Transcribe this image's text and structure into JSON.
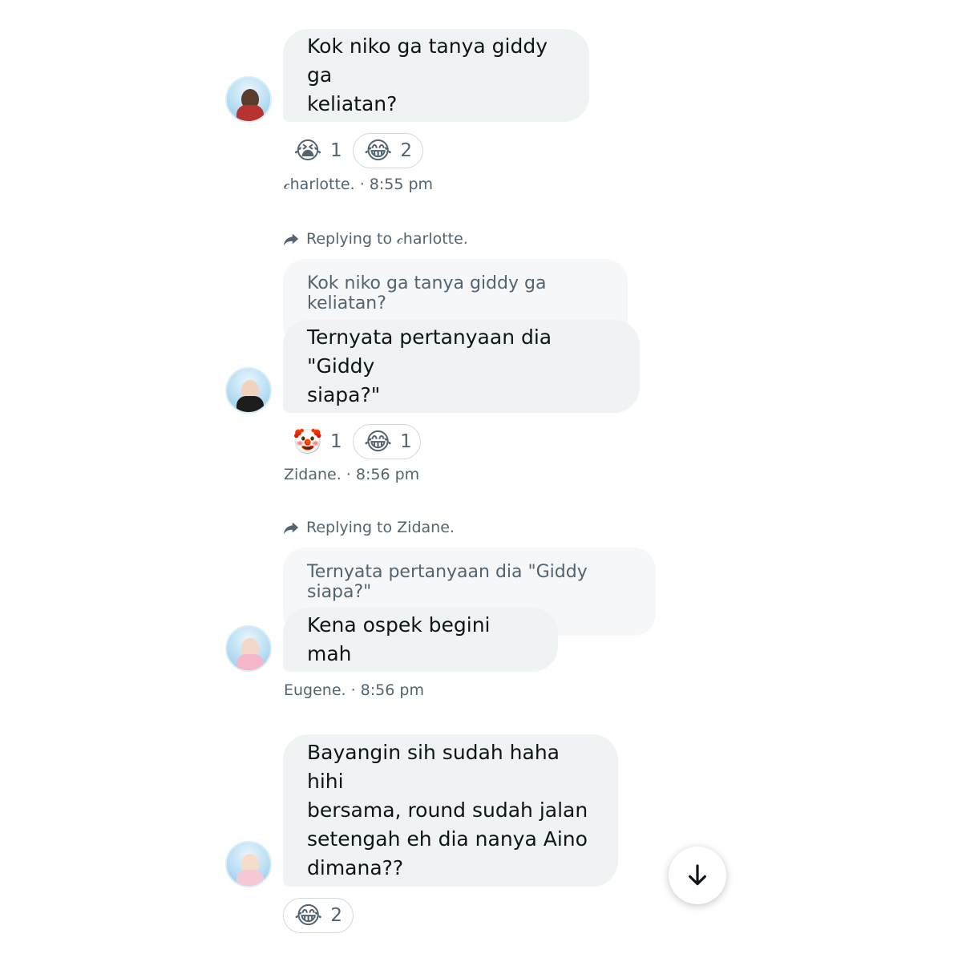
{
  "messages": [
    {
      "text": "Kok niko ga tanya giddy ga keliatan?",
      "lines": [
        "Kok niko ga tanya giddy ga",
        "keliatan?"
      ],
      "author": "𝒸harlotte.",
      "time": "8:55 pm",
      "meta": "𝒸harlotte. · 8:55 pm",
      "reactions": [
        {
          "emoji": "😭",
          "count": "1",
          "boxed": false
        },
        {
          "emoji": "😂",
          "count": "2",
          "boxed": true
        }
      ]
    },
    {
      "reply_hint": "Replying to 𝒸harlotte.",
      "quoted": "Kok niko ga tanya giddy ga keliatan?",
      "lines": [
        "Ternyata pertanyaan dia \"Giddy",
        "siapa?\""
      ],
      "author": "Zidane.",
      "time": "8:56 pm",
      "meta": "Zidane. · 8:56 pm",
      "reactions": [
        {
          "emoji": "🤡",
          "count": "1",
          "boxed": false
        },
        {
          "emoji": "😂",
          "count": "1",
          "boxed": true
        }
      ]
    },
    {
      "reply_hint": "Replying to Zidane.",
      "quoted": "Ternyata pertanyaan dia \"Giddy siapa?\"",
      "lines": [
        "Kena ospek begini mah"
      ],
      "author": "Eugene.",
      "time": "8:56 pm",
      "meta": "Eugene. · 8:56 pm"
    },
    {
      "lines": [
        "Bayangin sih sudah haha hihi",
        "bersama, round sudah jalan",
        "setengah eh dia nanya Aino",
        "dimana??"
      ],
      "reactions": [
        {
          "emoji": "😂",
          "count": "2",
          "boxed": true
        }
      ]
    }
  ],
  "scroll_button": {
    "icon": "arrow-down-icon",
    "glyph": "↓"
  },
  "colors": {
    "bubble": "#eff3f4",
    "quote": "#f5f7f8",
    "muted": "#536471",
    "text": "#0f1419"
  }
}
